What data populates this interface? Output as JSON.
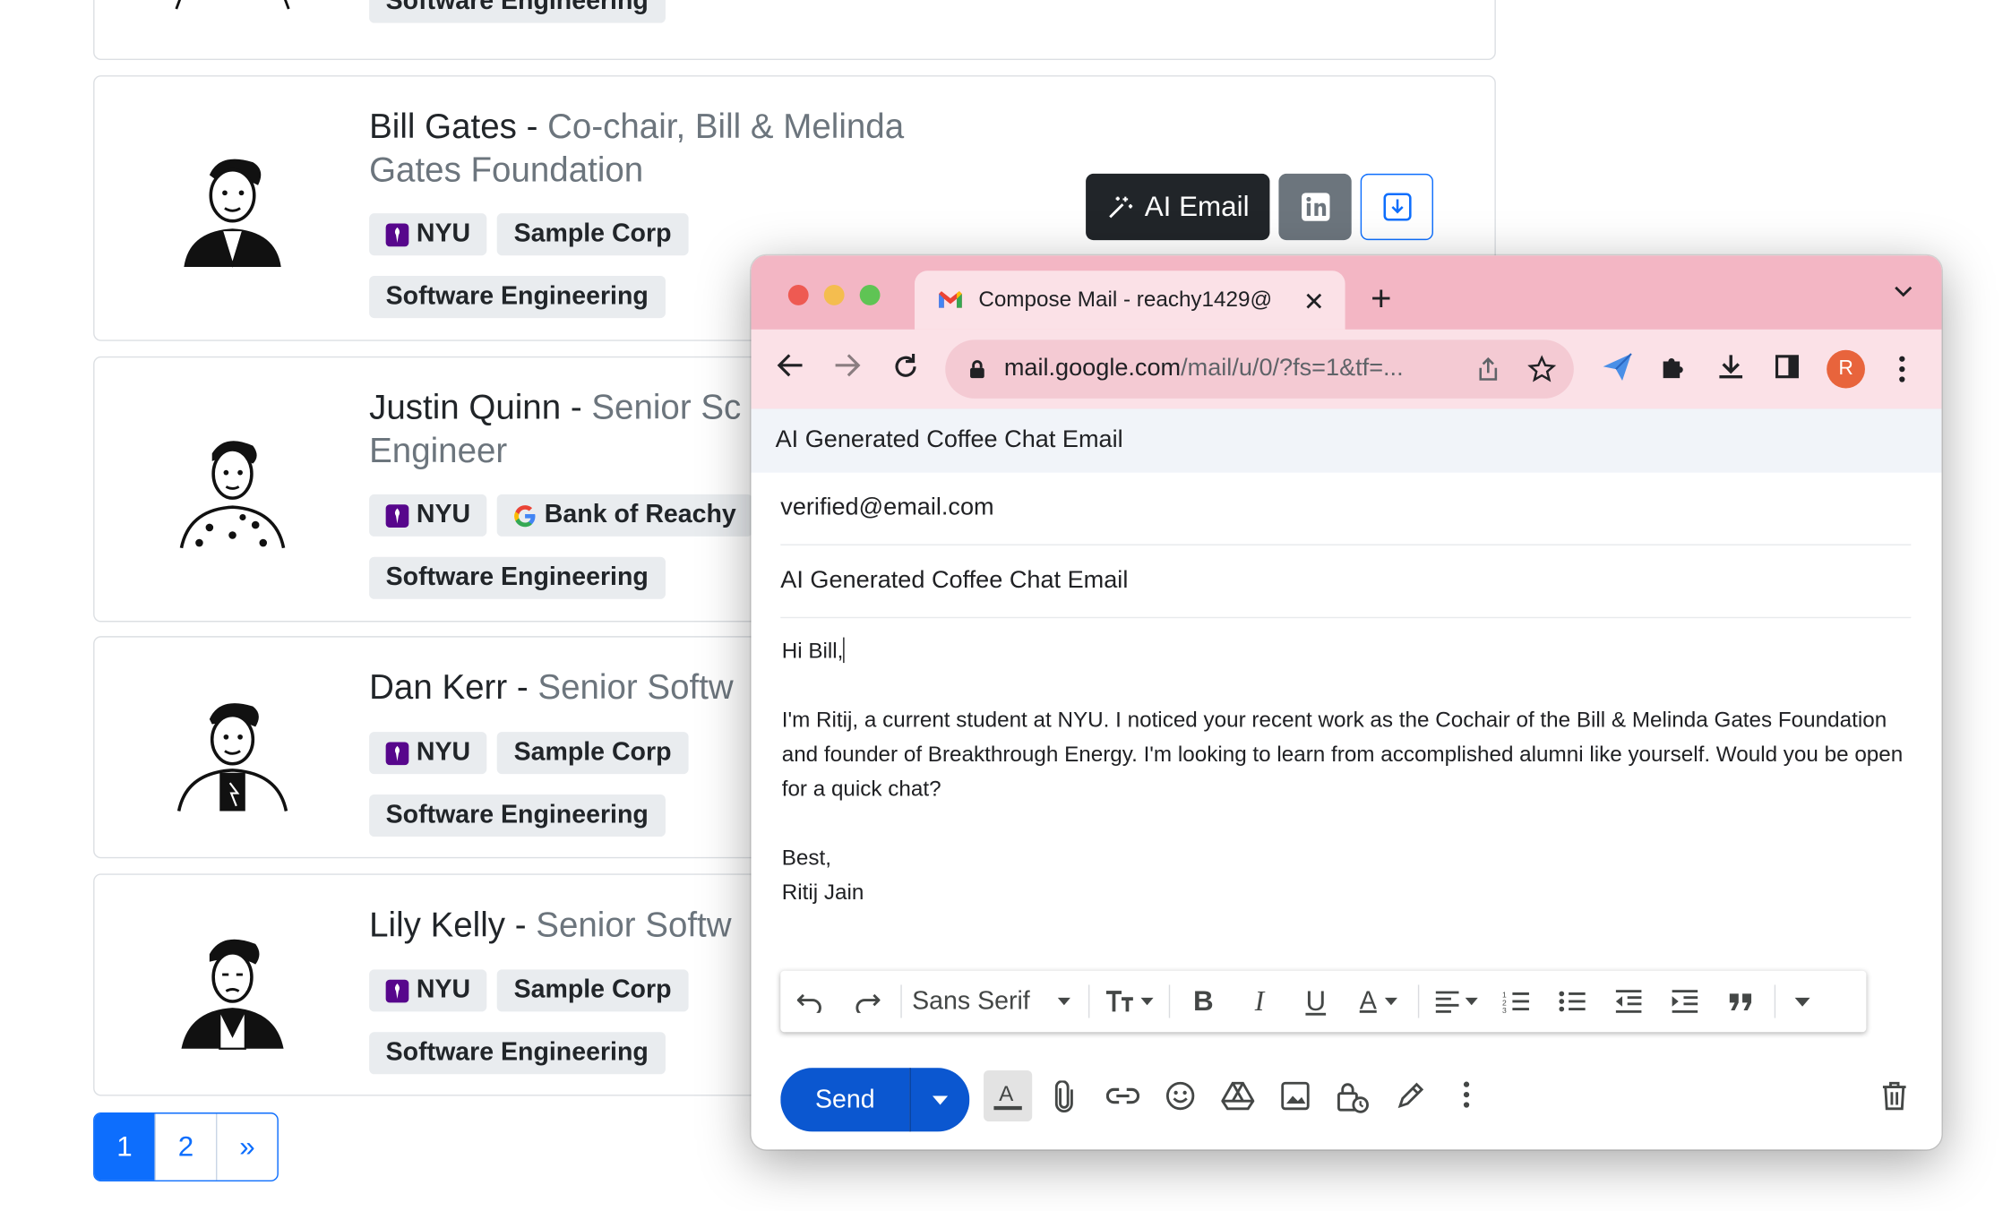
{
  "cards": [
    {
      "name": "Bill Gates",
      "sep": " - ",
      "role": "Co-chair, Bill & Melinda Gates Foundation",
      "tags": [
        "NYU",
        "Sample Corp",
        "Software Engineering"
      ]
    },
    {
      "name": "Justin Quinn",
      "sep": " - ",
      "role": "Senior Sc",
      "role2": "Engineer",
      "tags": [
        "NYU",
        "Bank of Reachy",
        "Software Engineering"
      ]
    },
    {
      "name": "Dan Kerr",
      "sep": " - ",
      "role": "Senior Softw",
      "tags": [
        "NYU",
        "Sample Corp",
        "Software Engineering"
      ]
    },
    {
      "name": "Lily Kelly",
      "sep": " - ",
      "role": "Senior Softw",
      "tags": [
        "NYU",
        "Sample Corp",
        "Software Engineering"
      ]
    }
  ],
  "top_partial_tag": "Software Engineering",
  "actions": {
    "ai_email": "AI Email"
  },
  "pagination": [
    "1",
    "2",
    "»"
  ],
  "browser": {
    "tab_title": "Compose Mail - reachy1429@",
    "url_host": "mail.google.com",
    "url_path": "/mail/u/0/?fs=1&tf=...",
    "profile_initial": "R"
  },
  "compose": {
    "header": "AI Generated Coffee Chat Email",
    "to": "verified@email.com",
    "subject": "AI Generated Coffee Chat Email",
    "greeting": "Hi Bill,",
    "paragraph": "I'm Ritij, a current student at NYU. I noticed your recent work as the Cochair of the Bill & Melinda Gates Foundation and founder of Breakthrough Energy. I'm looking to learn from accomplished alumni like yourself. Would you be open for a quick chat?",
    "signoff": "Best,",
    "signature": "Ritij Jain",
    "font": "Sans Serif",
    "send_label": "Send"
  },
  "colors": {
    "primary": "#0d6efd",
    "gmail_send": "#0b57d0",
    "tabbar": "#f3b6c4",
    "nyu": "#57068c"
  }
}
